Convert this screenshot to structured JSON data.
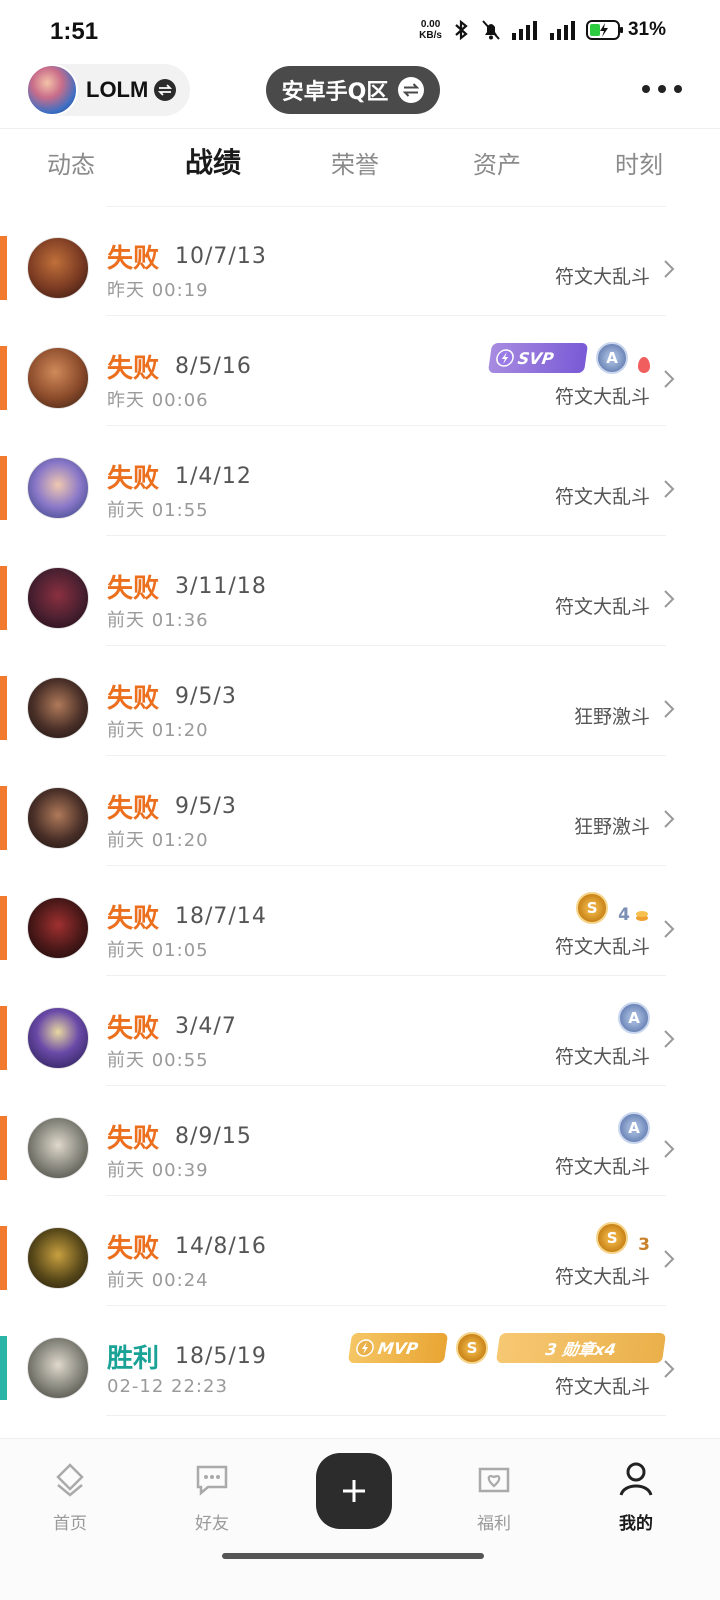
{
  "status_bar": {
    "time": "1:51",
    "speed_value": "0.00",
    "speed_unit": "KB/s",
    "battery": "31%"
  },
  "header": {
    "profile_name": "LOLM",
    "server_label": "安卓手Q区"
  },
  "tabs": [
    {
      "label": "动态",
      "active": false
    },
    {
      "label": "战绩",
      "active": true
    },
    {
      "label": "荣誉",
      "active": false
    },
    {
      "label": "资产",
      "active": false
    },
    {
      "label": "时刻",
      "active": false
    }
  ],
  "matches": [
    {
      "result": "失败",
      "outcome": "loss",
      "kda": "10/7/13",
      "time": "昨天 00:19",
      "mode": "符文大乱斗",
      "champion_color": "#7a3a22"
    },
    {
      "result": "失败",
      "outcome": "loss",
      "kda": "8/5/16",
      "time": "昨天 00:06",
      "mode": "符文大乱斗",
      "champion_color": "#8a4a2a",
      "badges": {
        "svp": "SVP",
        "coin_a": "A"
      }
    },
    {
      "result": "失败",
      "outcome": "loss",
      "kda": "1/4/12",
      "time": "前天 01:55",
      "mode": "符文大乱斗",
      "champion_color": "#5a6ab0"
    },
    {
      "result": "失败",
      "outcome": "loss",
      "kda": "3/11/18",
      "time": "前天 01:36",
      "mode": "符文大乱斗",
      "champion_color": "#4a2030"
    },
    {
      "result": "失败",
      "outcome": "loss",
      "kda": "9/5/3",
      "time": "前天 01:20",
      "mode": "狂野激斗",
      "champion_color": "#3a2a22"
    },
    {
      "result": "失败",
      "outcome": "loss",
      "kda": "9/5/3",
      "time": "前天 01:20",
      "mode": "狂野激斗",
      "champion_color": "#3a2a22"
    },
    {
      "result": "失败",
      "outcome": "loss",
      "kda": "18/7/14",
      "time": "前天 01:05",
      "mode": "符文大乱斗",
      "champion_color": "#5a1a1a",
      "badges": {
        "coin_s": "S",
        "count": "4"
      }
    },
    {
      "result": "失败",
      "outcome": "loss",
      "kda": "3/4/7",
      "time": "前天 00:55",
      "mode": "符文大乱斗",
      "champion_color": "#3a2a6a",
      "badges": {
        "coin_a": "A"
      }
    },
    {
      "result": "失败",
      "outcome": "loss",
      "kda": "8/9/15",
      "time": "前天 00:39",
      "mode": "符文大乱斗",
      "champion_color": "#8a8a80",
      "badges": {
        "coin_a": "A"
      }
    },
    {
      "result": "失败",
      "outcome": "loss",
      "kda": "14/8/16",
      "time": "前天 00:24",
      "mode": "符文大乱斗",
      "champion_color": "#5a4a1a",
      "badges": {
        "coin_s": "S",
        "count": "3"
      }
    },
    {
      "result": "胜利",
      "outcome": "win",
      "kda": "18/5/19",
      "time": "02-12 22:23",
      "mode": "符文大乱斗",
      "champion_color": "#8a8a80",
      "badges": {
        "mvp": "MVP",
        "coin_s": "S",
        "medal_text": "3 勋章x4"
      }
    }
  ],
  "bottom_nav": [
    {
      "label": "首页",
      "active": false,
      "icon": "home-icon"
    },
    {
      "label": "好友",
      "active": false,
      "icon": "chat-icon"
    },
    {
      "label": "福利",
      "active": false,
      "icon": "gift-heart-icon"
    },
    {
      "label": "我的",
      "active": true,
      "icon": "person-icon"
    }
  ],
  "colors": {
    "loss": "#ec6f1e",
    "win": "#1aa296",
    "dark": "#2c2c2c"
  }
}
